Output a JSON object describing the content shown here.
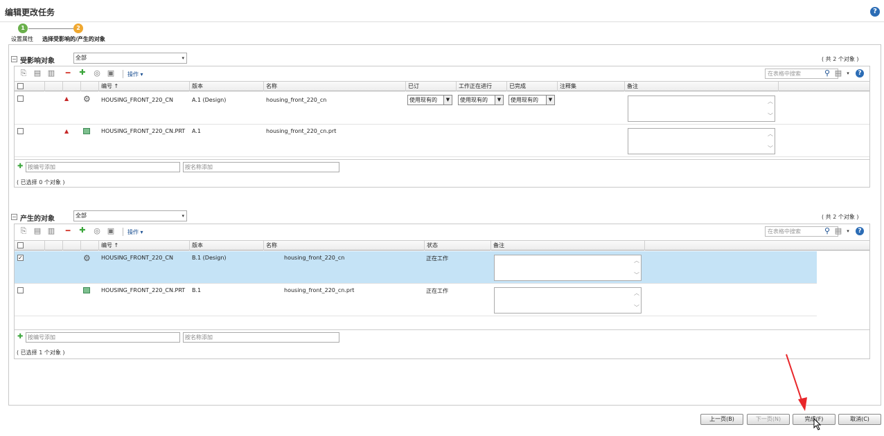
{
  "window": {
    "title": "编辑更改任务",
    "help_icon": "question-icon"
  },
  "wizard": {
    "steps": [
      {
        "number": "1",
        "label": "设置属性",
        "state": "done",
        "color": "#6ab04c"
      },
      {
        "number": "2",
        "label": "选择受影响的/产生的对象",
        "state": "current",
        "color": "#f0a830"
      }
    ]
  },
  "affected": {
    "title": "受影响对象",
    "filter_value": "全部",
    "count_text": "( 共 2 个对象 )",
    "toolbar": {
      "actions_label": "操作",
      "search_placeholder": "在表格中搜索"
    },
    "columns": [
      "编号 ↑",
      "版本",
      "名称",
      "已订",
      "工作正在进行",
      "已完成",
      "注释集",
      "备注"
    ],
    "rows": [
      {
        "number": "HOUSING_FRONT_220_CN",
        "version": "A.1 (Design)",
        "name": "housing_front_220_cn",
        "ordered": "使用现有的",
        "in_progress": "使用现有的",
        "completed": "使用现有的",
        "icon": "assembly-gear-icon",
        "status_icon": "warning-triangle-icon",
        "checked": false
      },
      {
        "number": "HOUSING_FRONT_220_CN.PRT",
        "version": "A.1",
        "name": "housing_front_220_cn.prt",
        "ordered": "",
        "in_progress": "",
        "completed": "",
        "icon": "part-cube-icon",
        "status_icon": "warning-triangle-icon",
        "checked": false
      }
    ],
    "add_by_number_placeholder": "按编号添加",
    "add_by_name_placeholder": "按名称添加",
    "selected_text": "( 已选择 0 个对象 )"
  },
  "resulting": {
    "title": "产生的对象",
    "filter_value": "全部",
    "count_text": "( 共 2 个对象 )",
    "toolbar": {
      "actions_label": "操作",
      "search_placeholder": "在表格中搜索"
    },
    "columns": [
      "编号 ↑",
      "版本",
      "名称",
      "状态",
      "备注"
    ],
    "rows": [
      {
        "number": "HOUSING_FRONT_220_CN",
        "version": "B.1 (Design)",
        "name": "housing_front_220_cn",
        "state": "正在工作",
        "icon": "assembly-gear-icon",
        "checked": true
      },
      {
        "number": "HOUSING_FRONT_220_CN.PRT",
        "version": "B.1",
        "name": "housing_front_220_cn.prt",
        "state": "正在工作",
        "icon": "part-cube-icon",
        "checked": false
      }
    ],
    "add_by_number_placeholder": "按编号添加",
    "add_by_name_placeholder": "按名称添加",
    "selected_text": "( 已选择 1 个对象 )"
  },
  "footer": {
    "prev_label": "上一页(B)",
    "next_label": "下一页(N)",
    "finish_label": "完成(F)",
    "cancel_label": "取消(C)"
  },
  "colors": {
    "selected_row": "#c5e3f6",
    "link_blue": "#1a4f91",
    "annotation_arrow": "#e8262a"
  }
}
